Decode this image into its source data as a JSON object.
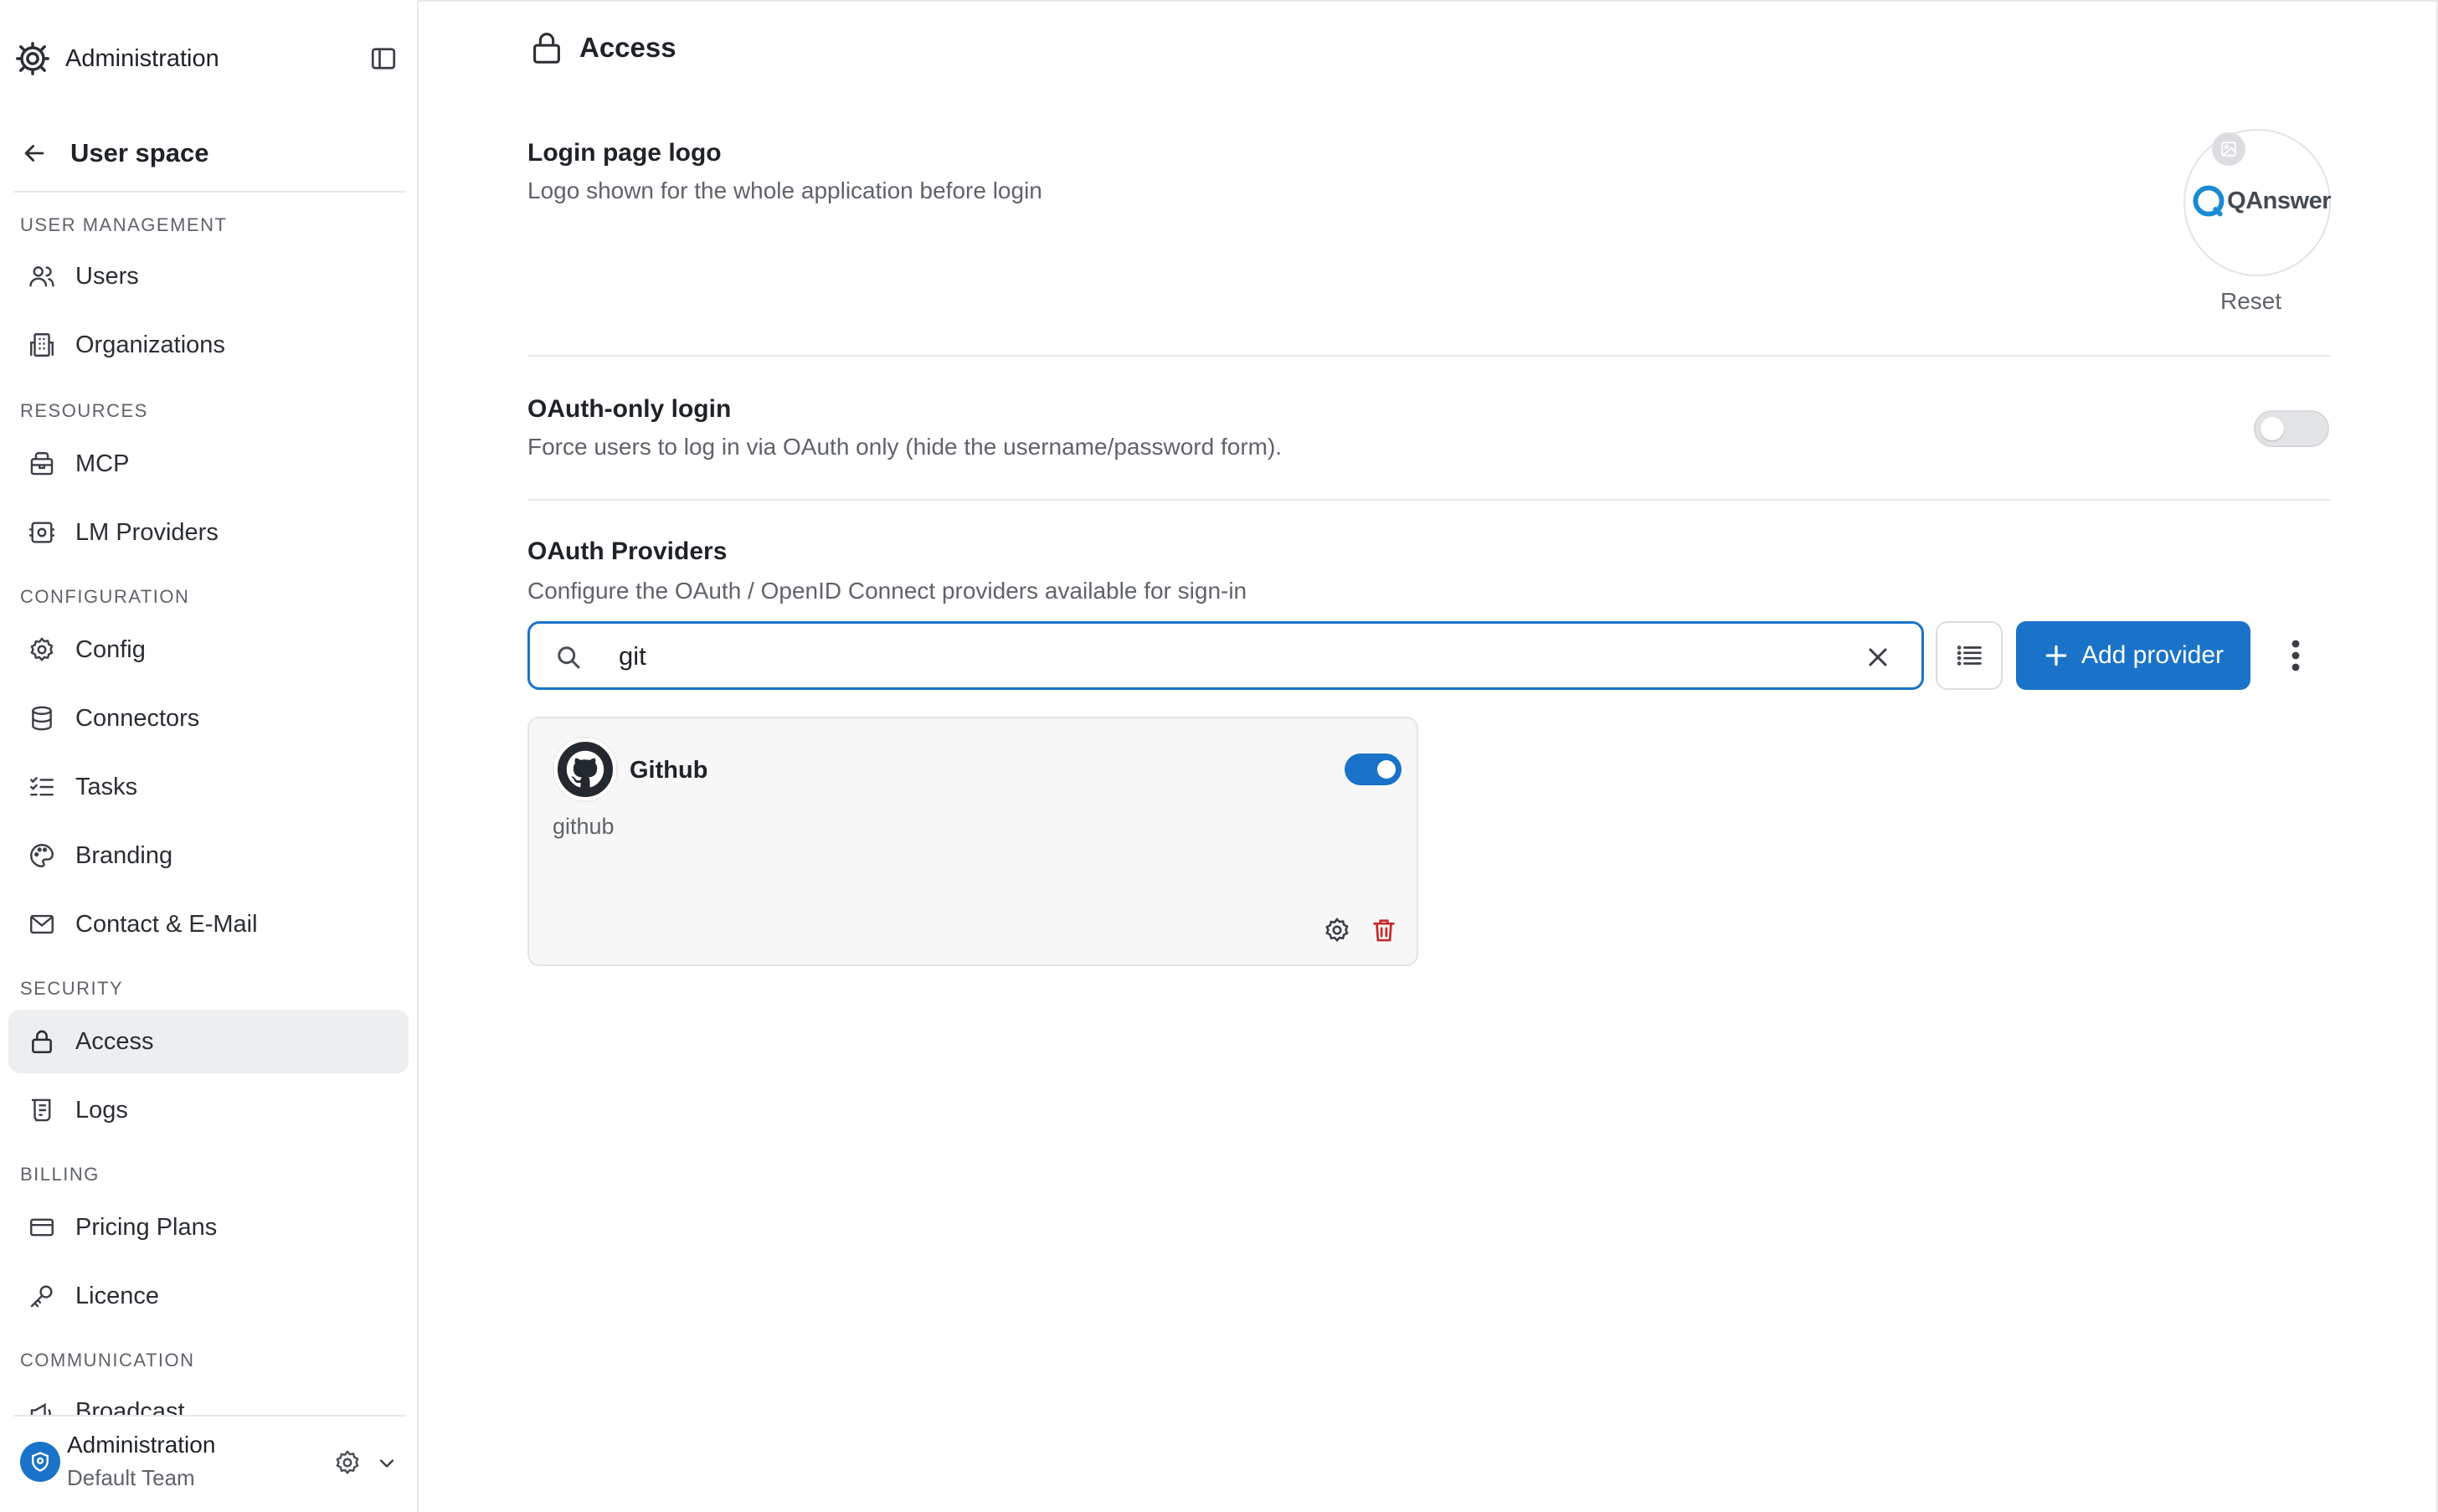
{
  "sidebar": {
    "app_title": "Administration",
    "back_label": "User space",
    "sections": {
      "user_management": "USER MANAGEMENT",
      "resources": "RESOURCES",
      "configuration": "CONFIGURATION",
      "security": "SECURITY",
      "billing": "BILLING",
      "communication": "COMMUNICATION"
    },
    "items": {
      "users": "Users",
      "organizations": "Organizations",
      "mcp": "MCP",
      "lm_providers": "LM Providers",
      "config": "Config",
      "connectors": "Connectors",
      "tasks": "Tasks",
      "branding": "Branding",
      "contact": "Contact & E-Mail",
      "access": "Access",
      "logs": "Logs",
      "pricing_plans": "Pricing Plans",
      "licence": "Licence",
      "broadcast": "Broadcast"
    },
    "active_item": "Access",
    "footer": {
      "name": "Administration",
      "team": "Default Team"
    }
  },
  "page": {
    "title": "Access",
    "login_logo": {
      "title": "Login page logo",
      "description": "Logo shown for the whole application before login",
      "logo_text": "QAnswer",
      "reset_label": "Reset"
    },
    "oauth_only": {
      "title": "OAuth-only login",
      "description": "Force users to log in via OAuth only (hide the username/password form).",
      "enabled": false
    },
    "oauth_providers": {
      "title": "OAuth Providers",
      "description": "Configure the OAuth / OpenID Connect providers available for sign-in",
      "search_value": "git",
      "add_button": "Add provider",
      "providers": [
        {
          "name": "Github",
          "slug": "github",
          "enabled": true
        }
      ]
    }
  },
  "colors": {
    "accent": "#1a73c8",
    "danger": "#c62828",
    "active_bg": "#eceeef"
  }
}
